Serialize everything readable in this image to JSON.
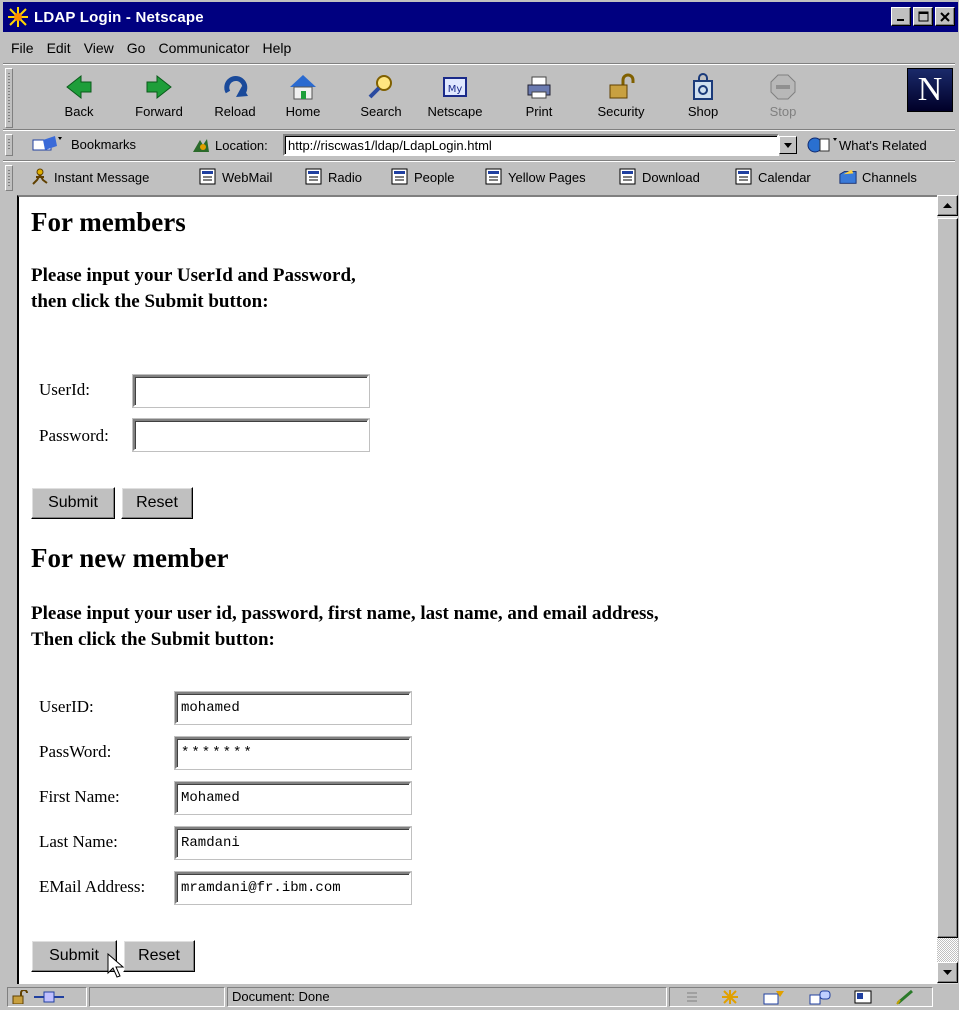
{
  "window": {
    "title": "LDAP Login - Netscape"
  },
  "menu": [
    "File",
    "Edit",
    "View",
    "Go",
    "Communicator",
    "Help"
  ],
  "nav_buttons": [
    {
      "label": "Back",
      "icon": "back-arrow-icon",
      "enabled": true
    },
    {
      "label": "Forward",
      "icon": "forward-arrow-icon",
      "enabled": true
    },
    {
      "label": "Reload",
      "icon": "reload-icon",
      "enabled": true
    },
    {
      "label": "Home",
      "icon": "home-icon",
      "enabled": true
    },
    {
      "label": "Search",
      "icon": "search-icon",
      "enabled": true
    },
    {
      "label": "Netscape",
      "icon": "my-netscape-icon",
      "enabled": true
    },
    {
      "label": "Print",
      "icon": "printer-icon",
      "enabled": true
    },
    {
      "label": "Security",
      "icon": "padlock-icon",
      "enabled": true
    },
    {
      "label": "Shop",
      "icon": "shopping-bag-icon",
      "enabled": true
    },
    {
      "label": "Stop",
      "icon": "stop-icon",
      "enabled": false
    }
  ],
  "location": {
    "bookmarks_label": "Bookmarks",
    "location_label": "Location:",
    "url": "http://riscwas1/ldap/LdapLogin.html",
    "related_label": "What's Related"
  },
  "personal_toolbar": [
    "Instant Message",
    "WebMail",
    "Radio",
    "People",
    "Yellow Pages",
    "Download",
    "Calendar",
    "Channels"
  ],
  "members": {
    "heading": "For members",
    "instruction_line1": "Please input your UserId and Password,",
    "instruction_line2": "then click the Submit button:",
    "userid_label": "UserId:",
    "userid_value": "",
    "password_label": "Password:",
    "password_value": "",
    "submit_label": "Submit",
    "reset_label": "Reset"
  },
  "new_member": {
    "heading": "For new member",
    "instruction_line1": "Please input your user id, password, first name, last name, and email address,",
    "instruction_line2": "Then click the Submit button:",
    "userid_label": "UserID:",
    "userid_value": "mohamed",
    "password_label": "PassWord:",
    "password_value": "*******",
    "firstname_label": "First Name:",
    "firstname_value": "Mohamed",
    "lastname_label": "Last Name:",
    "lastname_value": "Ramdani",
    "email_label": "EMail Address:",
    "email_value": "mramdani@fr.ibm.com",
    "submit_label": "Submit",
    "reset_label": "Reset"
  },
  "status": {
    "text": "Document: Done"
  },
  "colors": {
    "title_bar": "#000080",
    "chrome": "#c0c0c0",
    "content_bg": "#ffffff"
  }
}
